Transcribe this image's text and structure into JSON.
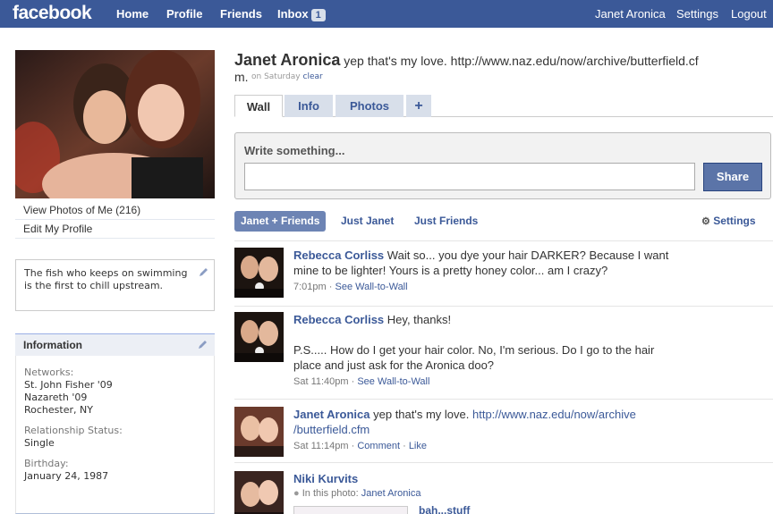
{
  "topbar": {
    "logo": "facebook",
    "nav": [
      "Home",
      "Profile",
      "Friends",
      "Inbox"
    ],
    "inbox_count": "1",
    "right": [
      "Janet Aronica",
      "Settings",
      "Logout"
    ]
  },
  "sidebar": {
    "view_photos": "View Photos of Me (216)",
    "edit_profile": "Edit My Profile",
    "bio": "The fish who keeps on swimming is the first to chill upstream.",
    "info_title": "Information",
    "networks_label": "Networks:",
    "networks": [
      "St. John Fisher '09",
      "Nazareth '09",
      "Rochester, NY"
    ],
    "relationship_label": "Relationship Status:",
    "relationship": "Single",
    "birthday_label": "Birthday:",
    "birthday": "January 24, 1987"
  },
  "profile": {
    "name": "Janet Aronica",
    "status_line1": "yep that's my love. http://www.naz.edu/now/archive/butterfield.cf",
    "status_line2": "m.",
    "status_time": "on Saturday",
    "clear": "clear"
  },
  "tabs": [
    "Wall",
    "Info",
    "Photos",
    "+"
  ],
  "composer": {
    "prompt": "Write something...",
    "input_value": "",
    "share": "Share"
  },
  "filters": {
    "items": [
      "Janet + Friends",
      "Just Janet",
      "Just Friends"
    ],
    "settings": "Settings"
  },
  "posts": [
    {
      "author": "Rebecca Corliss",
      "lines": [
        "Wait so... you dye your hair DARKER? Because I want",
        "mine to be lighter! Yours is a pretty honey color... am I crazy?"
      ],
      "time": "7:01pm",
      "action": "See Wall-to-Wall"
    },
    {
      "author": "Rebecca Corliss",
      "lines": [
        "Hey, thanks!",
        "",
        "P.S..... How do I get your hair color. No, I'm serious. Do I go to the hair",
        "place and just ask for the Aronica doo?"
      ],
      "time": "Sat 11:40pm",
      "action": "See Wall-to-Wall"
    },
    {
      "author": "Janet Aronica",
      "text": "yep that's my love.",
      "link1": "http://www.naz.edu/now/archive",
      "link2": "/butterfield.cfm",
      "time": "Sat 11:14pm",
      "comment": "Comment",
      "like": "Like"
    },
    {
      "author": "Niki Kurvits",
      "in_photo_label": "In this photo:",
      "in_photo_name": "Janet Aronica",
      "album": "bah...stuff"
    }
  ],
  "colors": {
    "brand": "#3b5998",
    "tab_bg": "#d8dfea",
    "button": "#5b74a8"
  }
}
